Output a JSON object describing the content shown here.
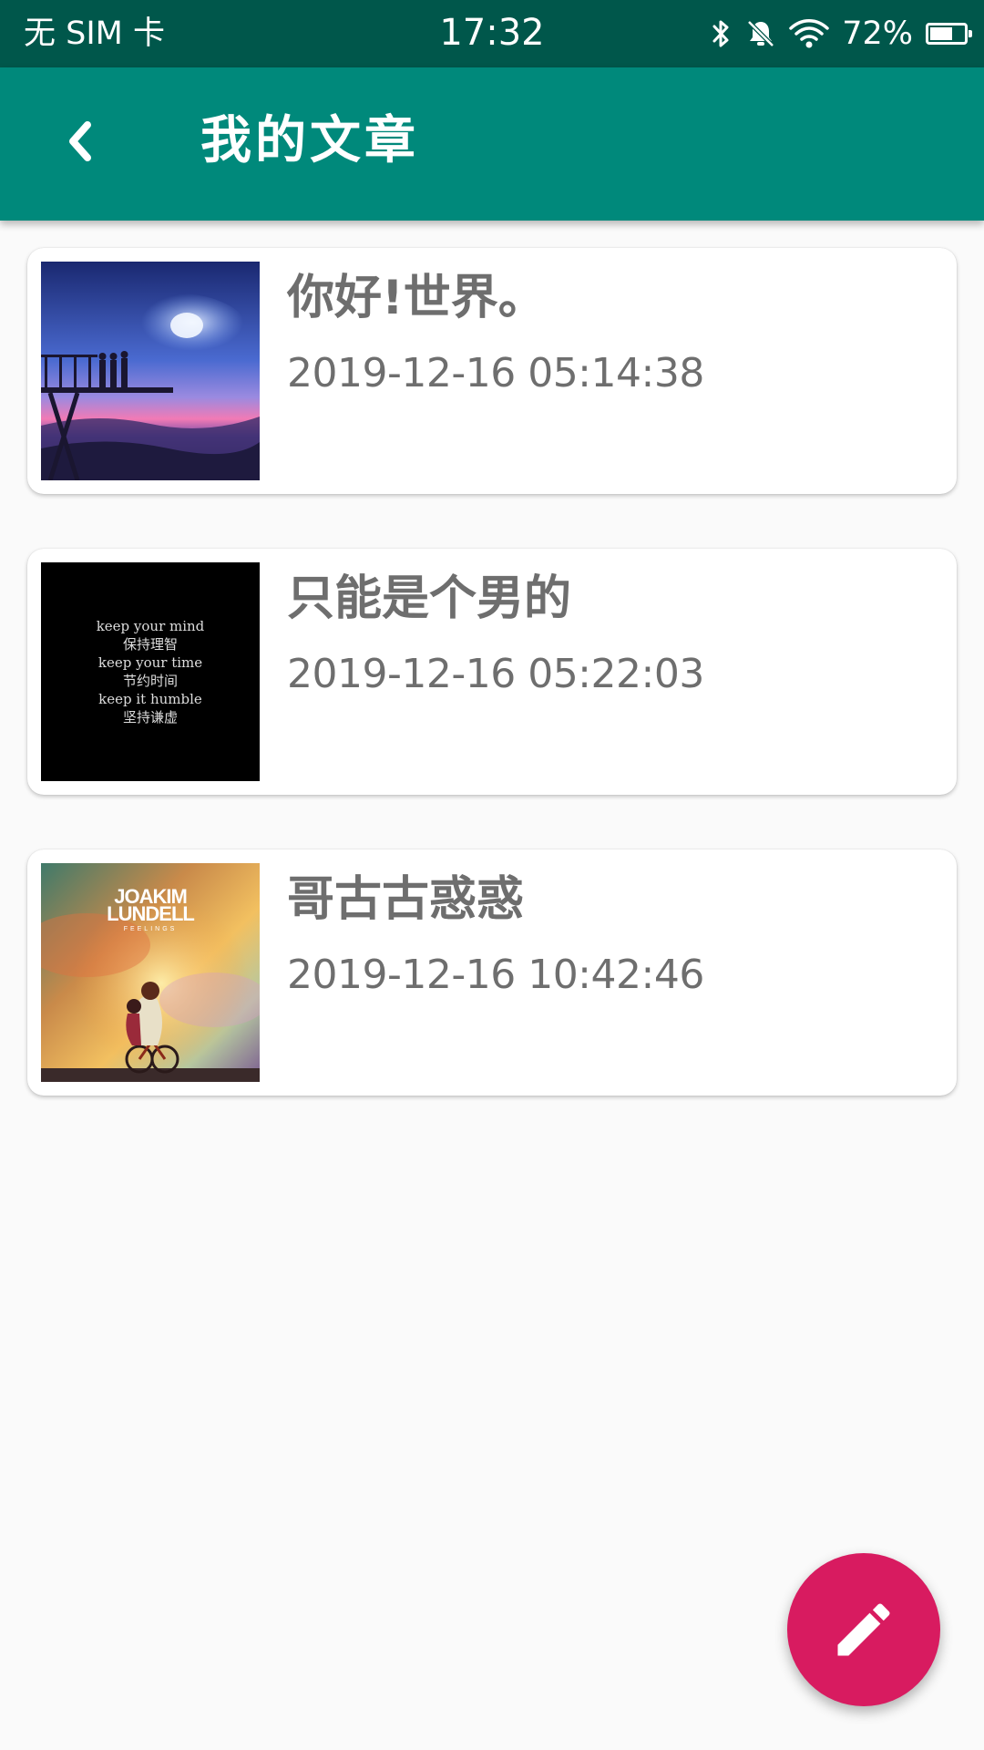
{
  "status_bar": {
    "carrier": "无 SIM 卡",
    "time": "17:32",
    "battery": "72%",
    "battery_level": 0.72,
    "icons": [
      "bluetooth-icon",
      "bell-off-icon",
      "wifi-icon",
      "battery-icon"
    ]
  },
  "app_bar": {
    "back_icon": "chevron-left-icon",
    "title": "我的文章"
  },
  "articles": [
    {
      "title": "你好!世界。",
      "date": "2019-12-16 05:14:38",
      "thumbnail": "night-sky-balcony-illustration"
    },
    {
      "title": "只能是个男的",
      "date": "2019-12-16 05:22:03",
      "thumbnail": "black-quote-image",
      "thumbnail_lines": [
        "keep your mind",
        "保持理智",
        "keep your time",
        "节约时间",
        "keep it humble",
        "坚持谦虚"
      ]
    },
    {
      "title": "哥古古惑惑",
      "date": "2019-12-16 10:42:46",
      "thumbnail": "album-cover-couple-bicycle",
      "thumbnail_lines": [
        "JOAKIM",
        "LUNDELL",
        "FEELINGS"
      ]
    }
  ],
  "fab": {
    "icon": "pencil-icon"
  },
  "colors": {
    "status_bar": "#00574b",
    "app_bar": "#00897b",
    "fab": "#d81b60",
    "text_gray": "#6e6e6e"
  }
}
